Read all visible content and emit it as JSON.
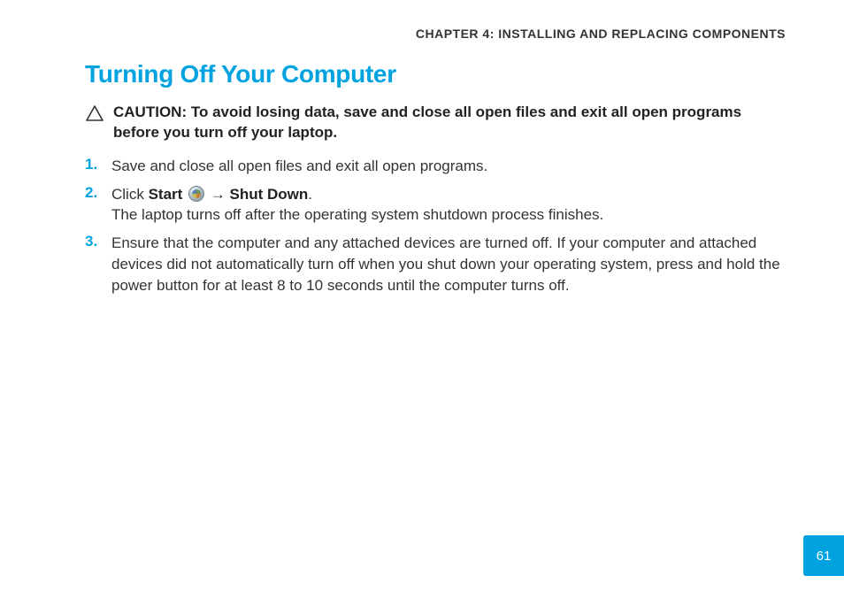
{
  "chapter_header": "CHAPTER 4: INSTALLING AND REPLACING COMPONENTS",
  "section_title": "Turning Off Your Computer",
  "caution": {
    "label": "CAUTION:",
    "text": "To avoid losing data, save and close all open files and exit all open programs before you turn off your laptop."
  },
  "steps": [
    {
      "num": "1.",
      "text": "Save and close all open files and exit all open programs."
    },
    {
      "num": "2.",
      "line1_prefix": "Click ",
      "line1_bold1": "Start",
      "line1_arrow": " → ",
      "line1_bold2": "Shut Down",
      "line1_suffix": ".",
      "line2": "The laptop turns off after the operating system shutdown process finishes."
    },
    {
      "num": "3.",
      "text": "Ensure that the computer and any attached devices are turned off. If your computer and attached devices did not automatically turn off when you shut down your operating system, press and hold the power button for at least 8 to 10 seconds until the computer turns off."
    }
  ],
  "page_number": "61"
}
